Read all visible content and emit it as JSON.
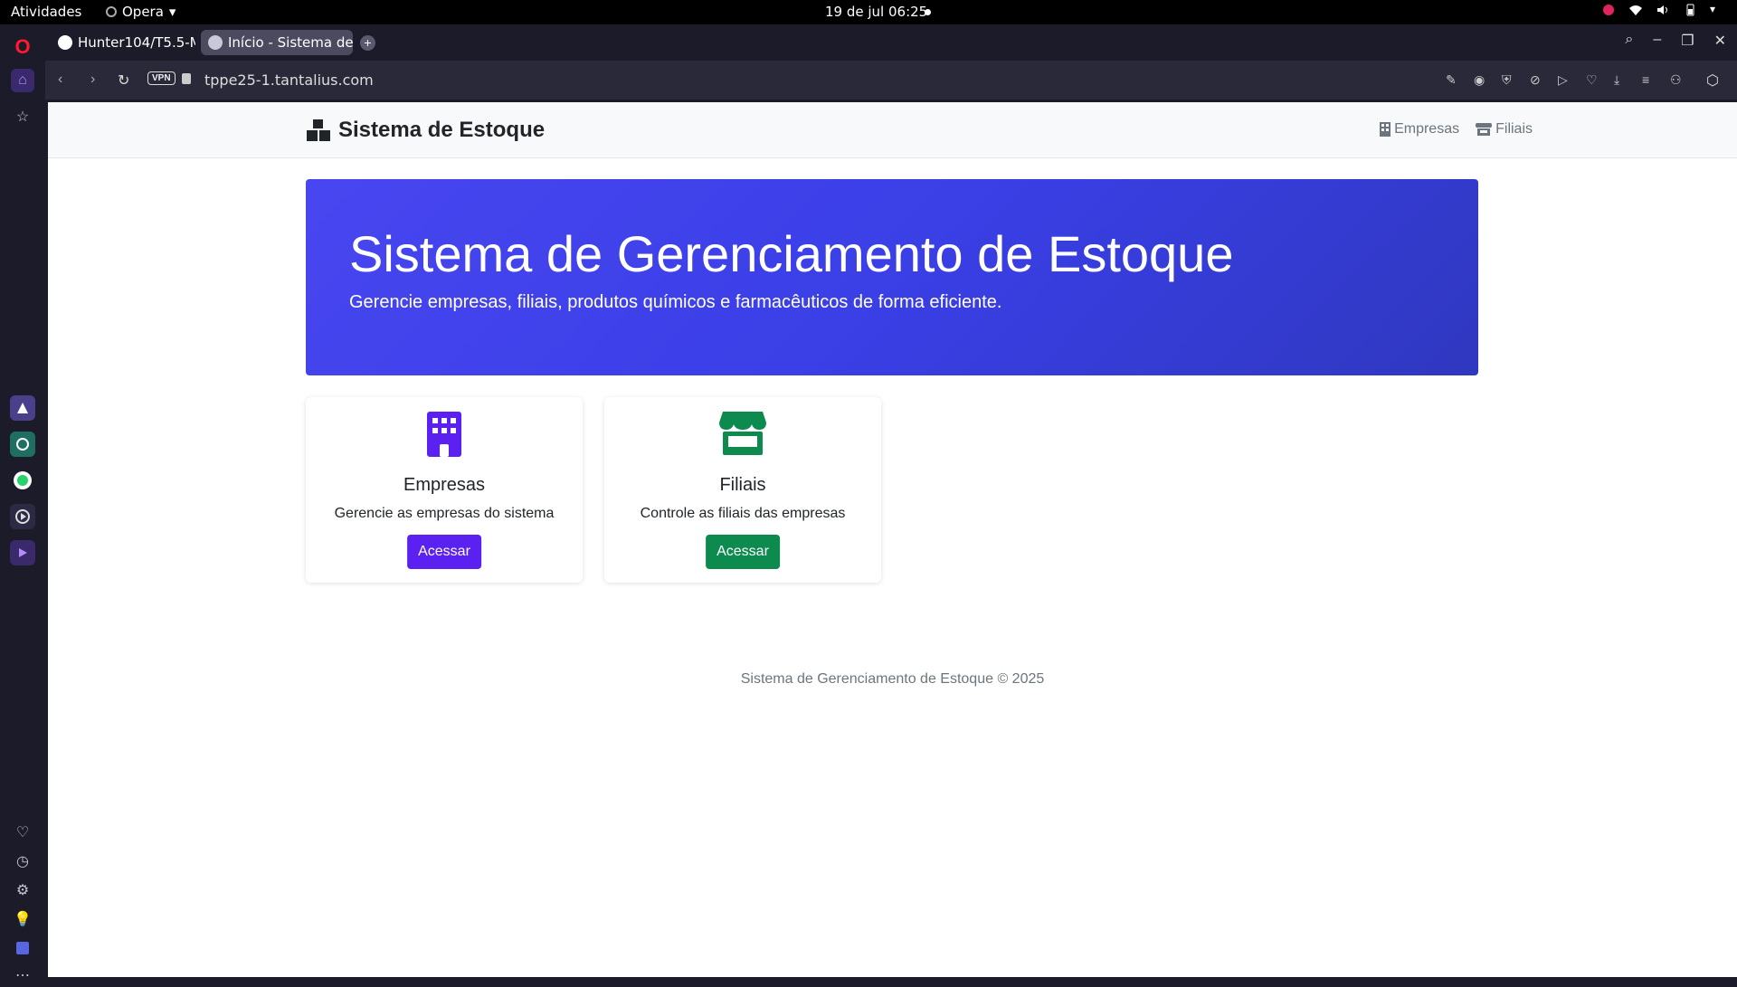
{
  "system": {
    "activities": "Atividades",
    "app_name": "Opera",
    "clock": "19 de jul  06:25"
  },
  "browser": {
    "tabs": [
      {
        "label": "Hunter104/T5.5-M_"
      },
      {
        "label": "Início - Sistema de E"
      }
    ],
    "vpn_label": "VPN",
    "url": "tppe25-1.tantalius.com"
  },
  "site": {
    "brand": "Sistema de Estoque",
    "nav": [
      {
        "label": "Empresas"
      },
      {
        "label": "Filiais"
      }
    ],
    "hero": {
      "title": "Sistema de Gerenciamento de Estoque",
      "subtitle": "Gerencie empresas, filiais, produtos químicos e farmacêuticos de forma eficiente."
    },
    "cards": [
      {
        "title": "Empresas",
        "description": "Gerencie as empresas do sistema",
        "button": "Acessar",
        "color": "#5b21f0",
        "icon": "building-icon"
      },
      {
        "title": "Filiais",
        "description": "Controle as filiais das empresas",
        "button": "Acessar",
        "color": "#0d8a4e",
        "icon": "store-icon"
      }
    ],
    "footer": "Sistema de Gerenciamento de Estoque © 2025"
  },
  "colors": {
    "hero_start": "#4846f0",
    "hero_end": "#2f38c0",
    "primary": "#5b21f0",
    "success": "#0d8a4e"
  }
}
